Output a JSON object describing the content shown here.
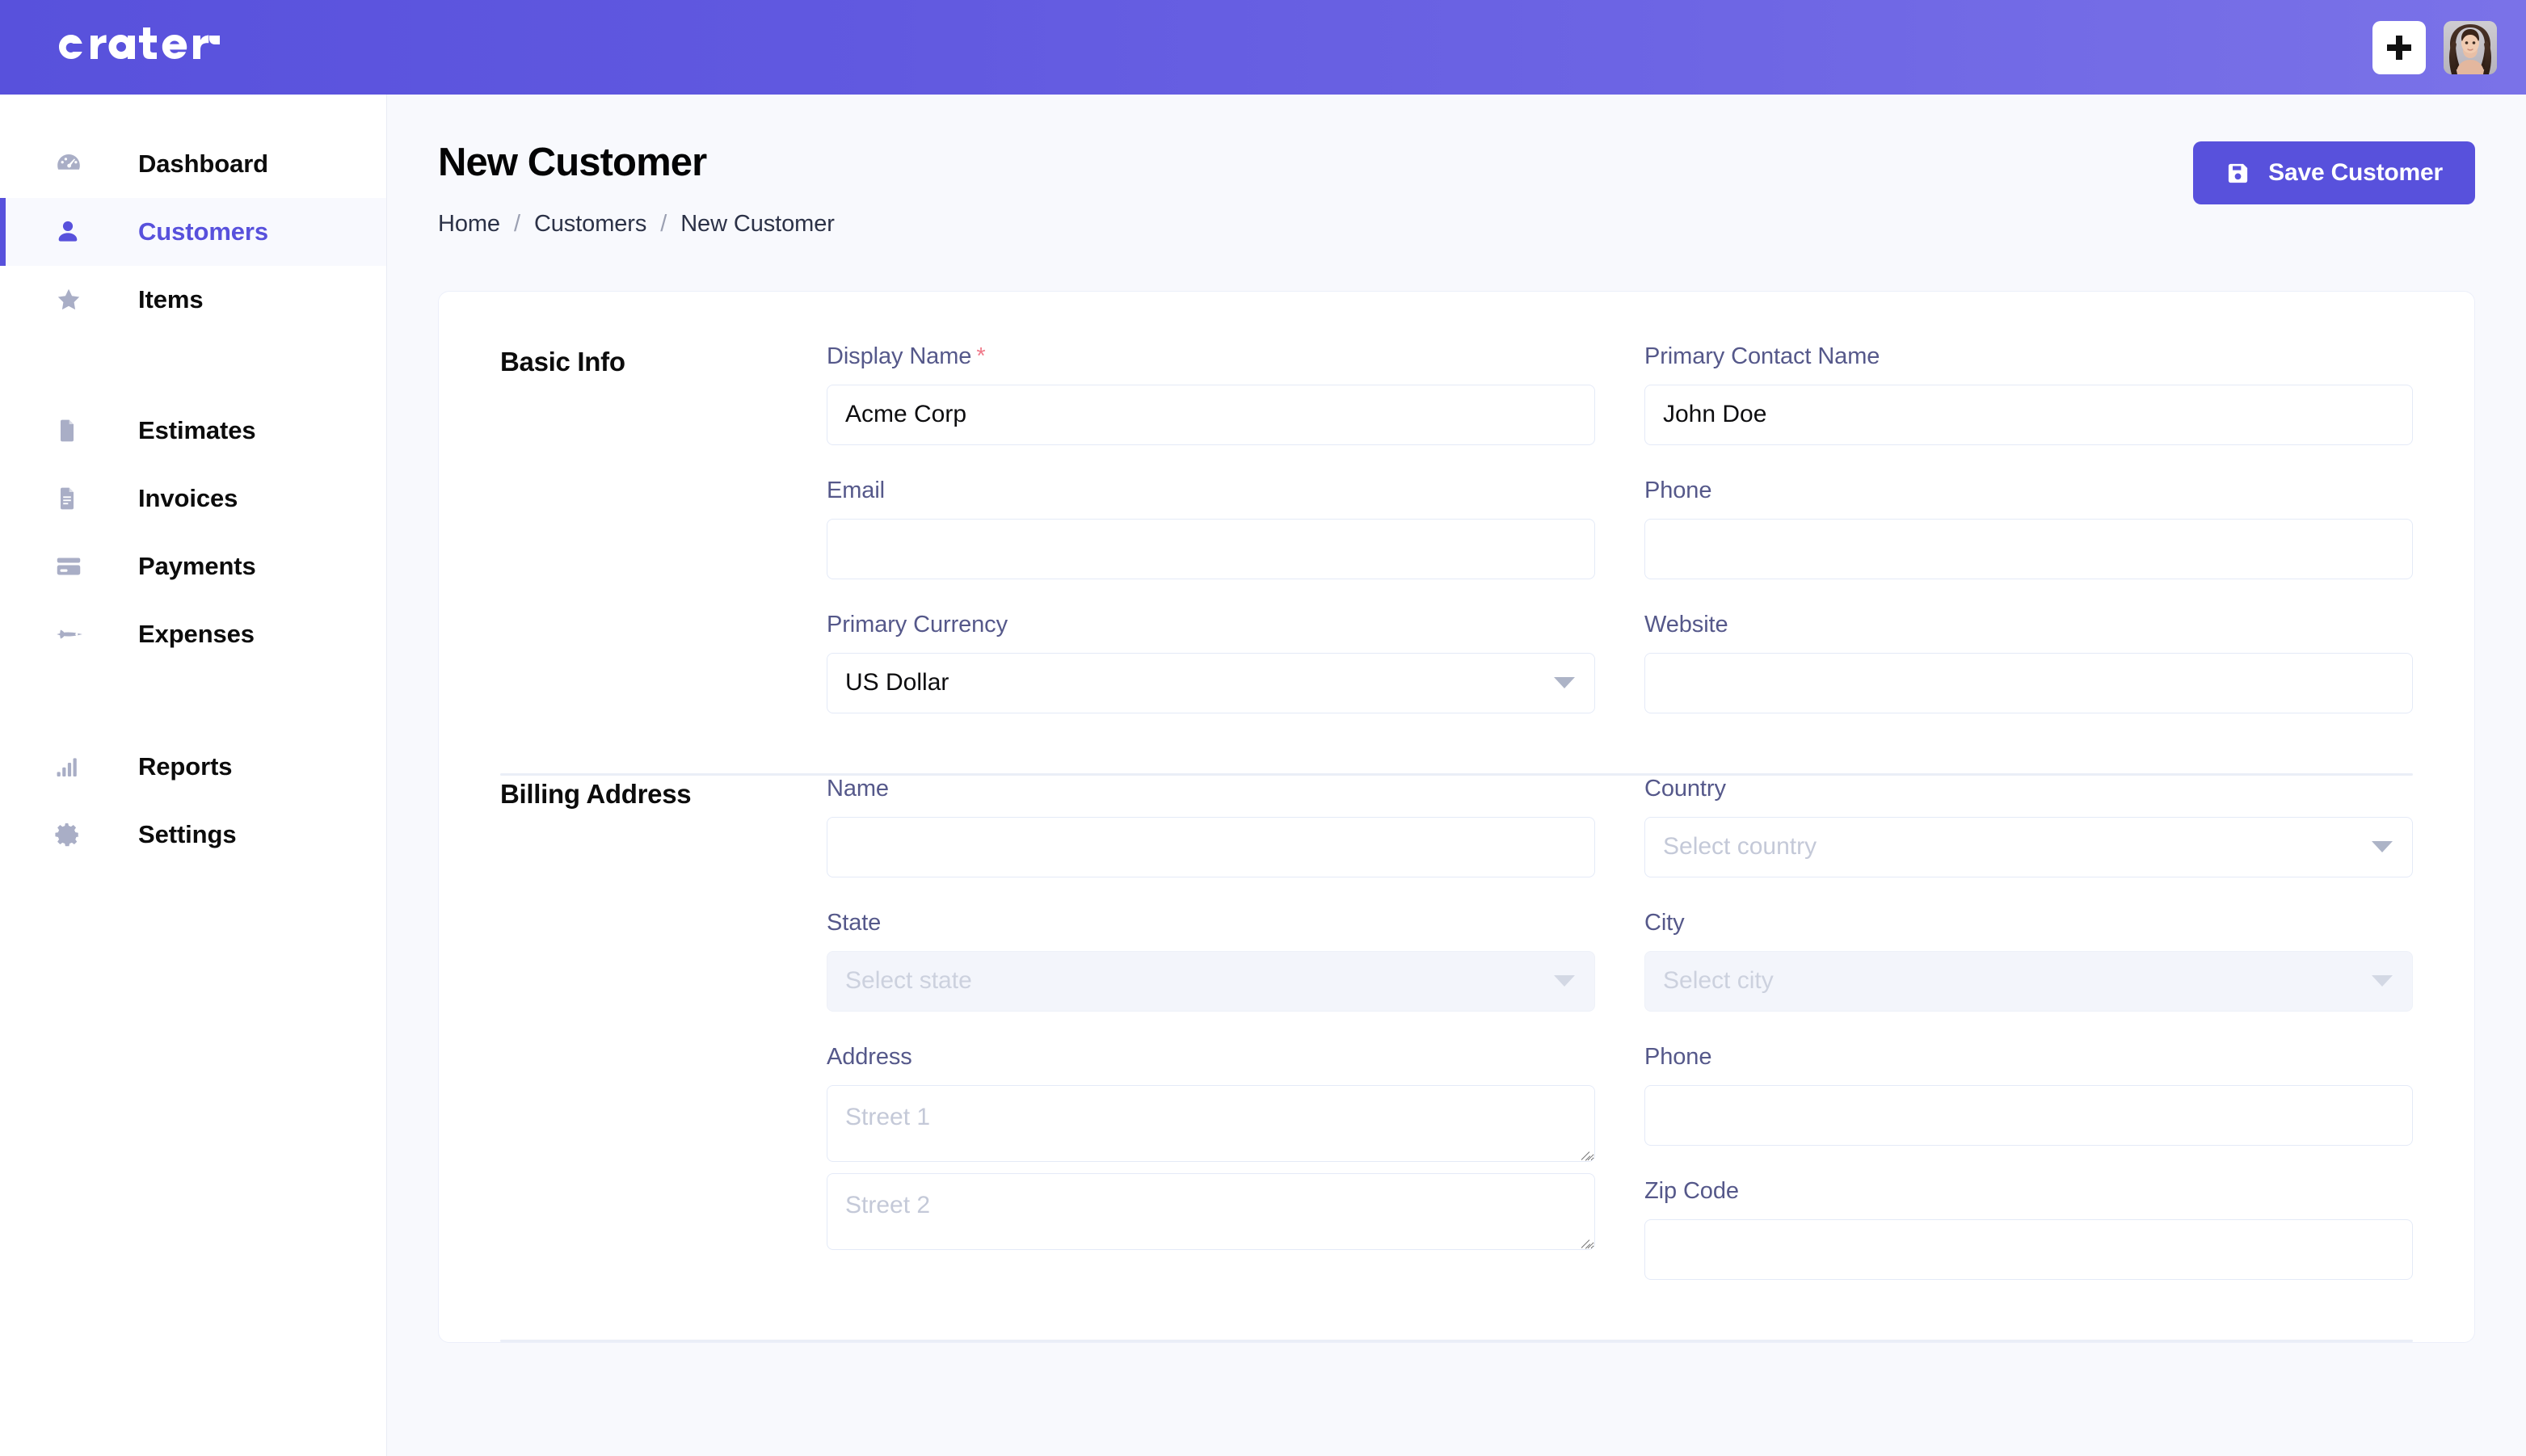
{
  "brand": {
    "name": "crater",
    "accent": "#5851dc",
    "header_gradient_from": "#5851dc",
    "header_gradient_to": "#7a72e8"
  },
  "topbar": {
    "add_icon": "plus-icon",
    "avatar_icon": "user-avatar"
  },
  "sidebar": {
    "items": [
      {
        "label": "Dashboard",
        "icon": "dashboard-icon",
        "active": false
      },
      {
        "label": "Customers",
        "icon": "user-icon",
        "active": true
      },
      {
        "label": "Items",
        "icon": "star-icon",
        "active": false
      },
      {
        "label": "Estimates",
        "icon": "document-icon",
        "active": false
      },
      {
        "label": "Invoices",
        "icon": "invoice-icon",
        "active": false
      },
      {
        "label": "Payments",
        "icon": "credit-card-icon",
        "active": false
      },
      {
        "label": "Expenses",
        "icon": "rocket-icon",
        "active": false
      },
      {
        "label": "Reports",
        "icon": "bar-chart-icon",
        "active": false
      },
      {
        "label": "Settings",
        "icon": "gear-icon",
        "active": false
      }
    ]
  },
  "page": {
    "title": "New Customer",
    "breadcrumb": [
      {
        "label": "Home",
        "link": true
      },
      {
        "label": "Customers",
        "link": true
      },
      {
        "label": "New Customer",
        "link": false
      }
    ],
    "breadcrumb_separator": "/",
    "save_label": "Save Customer",
    "save_icon": "save-icon"
  },
  "basic_info": {
    "title": "Basic Info",
    "display_name": {
      "label": "Display Name",
      "required": true,
      "required_mark": "*",
      "value": "Acme Corp",
      "placeholder": ""
    },
    "primary_contact_name": {
      "label": "Primary Contact Name",
      "value": "John Doe",
      "placeholder": ""
    },
    "email": {
      "label": "Email",
      "value": "",
      "placeholder": ""
    },
    "phone": {
      "label": "Phone",
      "value": "",
      "placeholder": ""
    },
    "primary_currency": {
      "label": "Primary Currency",
      "value": "US Dollar",
      "icon": "chevron-down-icon",
      "disabled": false
    },
    "website": {
      "label": "Website",
      "value": "",
      "placeholder": ""
    }
  },
  "billing_address": {
    "title": "Billing Address",
    "name": {
      "label": "Name",
      "value": "",
      "placeholder": ""
    },
    "country": {
      "label": "Country",
      "value": "",
      "placeholder": "Select country",
      "icon": "chevron-down-icon",
      "disabled": false
    },
    "state": {
      "label": "State",
      "value": "",
      "placeholder": "Select state",
      "icon": "chevron-down-icon",
      "disabled": true
    },
    "city": {
      "label": "City",
      "value": "",
      "placeholder": "Select city",
      "icon": "chevron-down-icon",
      "disabled": true
    },
    "address": {
      "label": "Address",
      "street1_placeholder": "Street 1",
      "street1_value": "",
      "street2_placeholder": "Street 2",
      "street2_value": ""
    },
    "phone": {
      "label": "Phone",
      "value": "",
      "placeholder": ""
    },
    "zip_code": {
      "label": "Zip Code",
      "value": "",
      "placeholder": ""
    }
  }
}
